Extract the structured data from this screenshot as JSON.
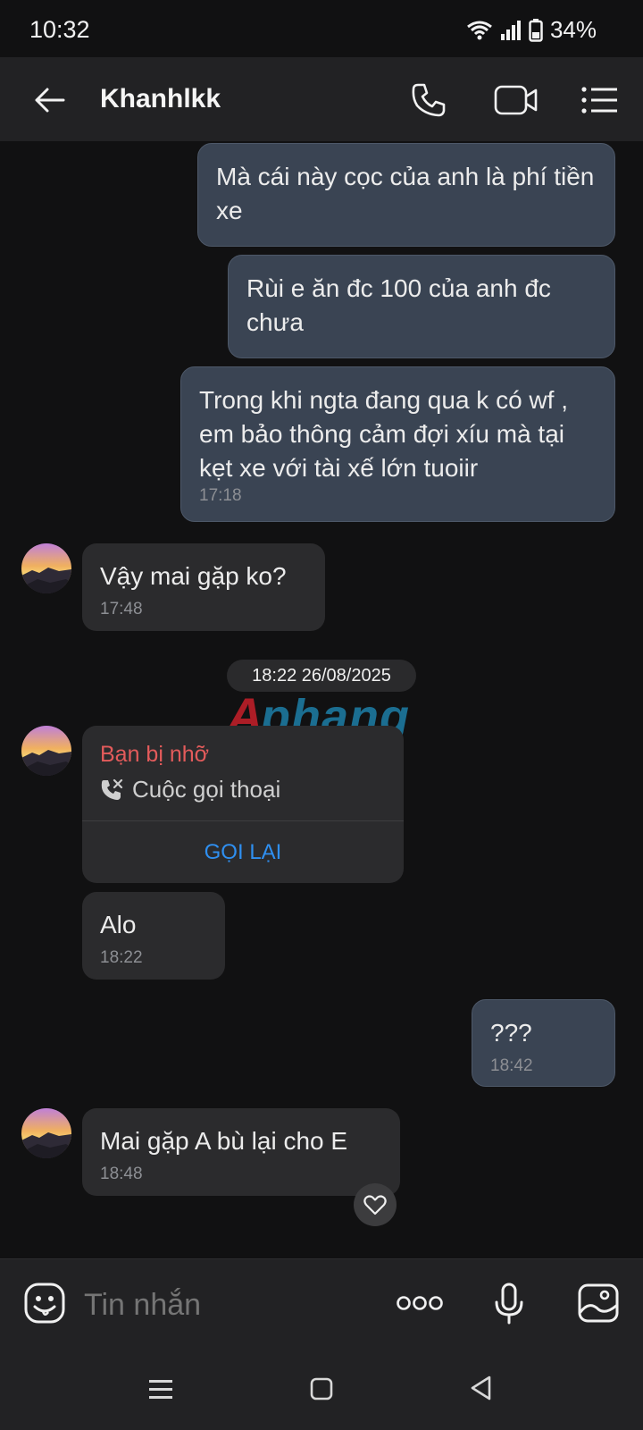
{
  "status_bar": {
    "time": "10:32",
    "battery": "34%"
  },
  "header": {
    "contact_name": "Khanhlkk"
  },
  "messages": [
    {
      "dir": "out",
      "text": "Mà cái này cọc của anh là phí tiền xe",
      "time": ""
    },
    {
      "dir": "out",
      "text": "Rùi e ăn đc 100 của anh đc chưa",
      "time": ""
    },
    {
      "dir": "out",
      "text": "Trong khi ngta đang qua k có wf , em bảo thông cảm đợi xíu mà tại kẹt xe với tài xế lớn tuoiir",
      "time": "17:18"
    },
    {
      "dir": "in",
      "text": "Vậy mai gặp ko?",
      "time": "17:48"
    },
    {
      "dir": "in",
      "text": "Alo",
      "time": "18:22"
    },
    {
      "dir": "out",
      "text": "???",
      "time": "18:42"
    },
    {
      "dir": "in",
      "text": "Mai gặp A bù lại cho E",
      "time": "18:48"
    }
  ],
  "date_separator": "18:22 26/08/2025",
  "watermark": "Aphang",
  "missed_call": {
    "title": "Bạn bị nhỡ",
    "subtitle": "Cuộc gọi thoại",
    "action": "GỌI LẠI"
  },
  "composer": {
    "placeholder": "Tin nhắn"
  },
  "colors": {
    "outgoing_bubble": "#3a4453",
    "incoming_bubble": "#2b2b2d",
    "missed_call_red": "#e35b5b",
    "call_back_blue": "#2f8ff0"
  },
  "icons": [
    "back-arrow-icon",
    "phone-icon",
    "video-icon",
    "menu-list-icon",
    "sticker-icon",
    "more-icon",
    "mic-icon",
    "image-icon",
    "heart-icon",
    "missed-call-icon"
  ]
}
